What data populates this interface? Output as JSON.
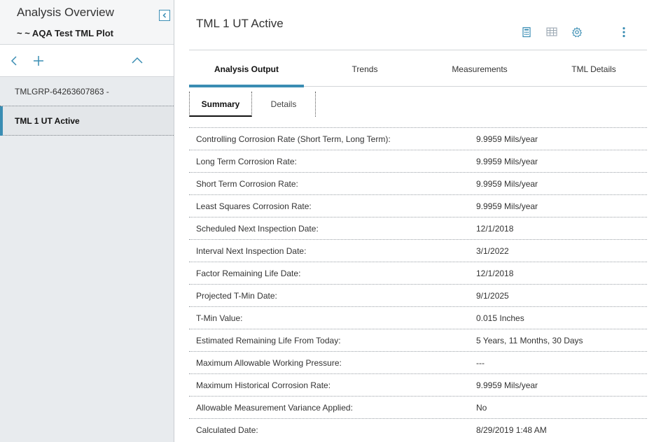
{
  "sidebar": {
    "title": "Analysis Overview",
    "subtitle": "~ ~ AQA Test TML Plot",
    "items": [
      {
        "label": "TMLGRP-64263607863 -"
      },
      {
        "label": "TML 1 UT Active"
      }
    ]
  },
  "header": {
    "title": "TML 1 UT Active"
  },
  "tabs": [
    {
      "label": "Analysis Output"
    },
    {
      "label": "Trends"
    },
    {
      "label": "Measurements"
    },
    {
      "label": "TML Details"
    }
  ],
  "subtabs": [
    {
      "label": "Summary"
    },
    {
      "label": "Details"
    }
  ],
  "summary": [
    {
      "label": "Controlling Corrosion Rate (Short Term, Long Term):",
      "value": "9.9959 Mils/year"
    },
    {
      "label": "Long Term Corrosion Rate:",
      "value": "9.9959 Mils/year"
    },
    {
      "label": "Short Term Corrosion Rate:",
      "value": "9.9959 Mils/year"
    },
    {
      "label": "Least Squares Corrosion Rate:",
      "value": "9.9959 Mils/year"
    },
    {
      "label": "Scheduled Next Inspection Date:",
      "value": "12/1/2018"
    },
    {
      "label": "Interval Next Inspection Date:",
      "value": "3/1/2022"
    },
    {
      "label": "Factor Remaining Life Date:",
      "value": "12/1/2018"
    },
    {
      "label": "Projected T-Min Date:",
      "value": "9/1/2025"
    },
    {
      "label": "T-Min Value:",
      "value": "0.015 Inches"
    },
    {
      "label": "Estimated Remaining Life From Today:",
      "value": "5 Years, 11 Months, 30 Days"
    },
    {
      "label": "Maximum Allowable Working Pressure:",
      "value": "---"
    },
    {
      "label": "Maximum Historical Corrosion Rate:",
      "value": "9.9959 Mils/year"
    },
    {
      "label": "Allowable Measurement Variance Applied:",
      "value": "No"
    },
    {
      "label": "Calculated Date:",
      "value": "8/29/2019 1:48 AM"
    }
  ],
  "colors": {
    "accent": "#3a8db3",
    "sidebar_bg": "#e8ebee"
  }
}
